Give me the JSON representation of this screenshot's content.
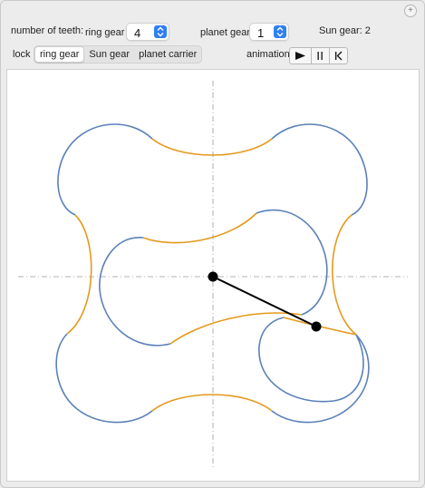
{
  "controls": {
    "teeth_label": "number of teeth:",
    "ring_gear_label": "ring gear",
    "ring_gear_value": "4",
    "planet_gear_label": "planet gear",
    "planet_gear_value": "1",
    "sun_gear_readout": "Sun gear: 2",
    "lock_label": "lock",
    "lock_options": [
      "ring gear",
      "Sun gear",
      "planet carrier"
    ],
    "lock_selected": "ring gear",
    "animation_label": "animation",
    "add_symbol": "+"
  },
  "colors": {
    "curve_blue": "#5b81b8",
    "curve_orange": "#e39a1c",
    "axis_gray": "#9a9a9a",
    "carrier_black": "#000000",
    "selector_blue": "#2f7ff5"
  },
  "icons": [
    "plus-icon",
    "stepper-arrows-icon",
    "play-icon",
    "pause-icon",
    "reset-icon"
  ]
}
